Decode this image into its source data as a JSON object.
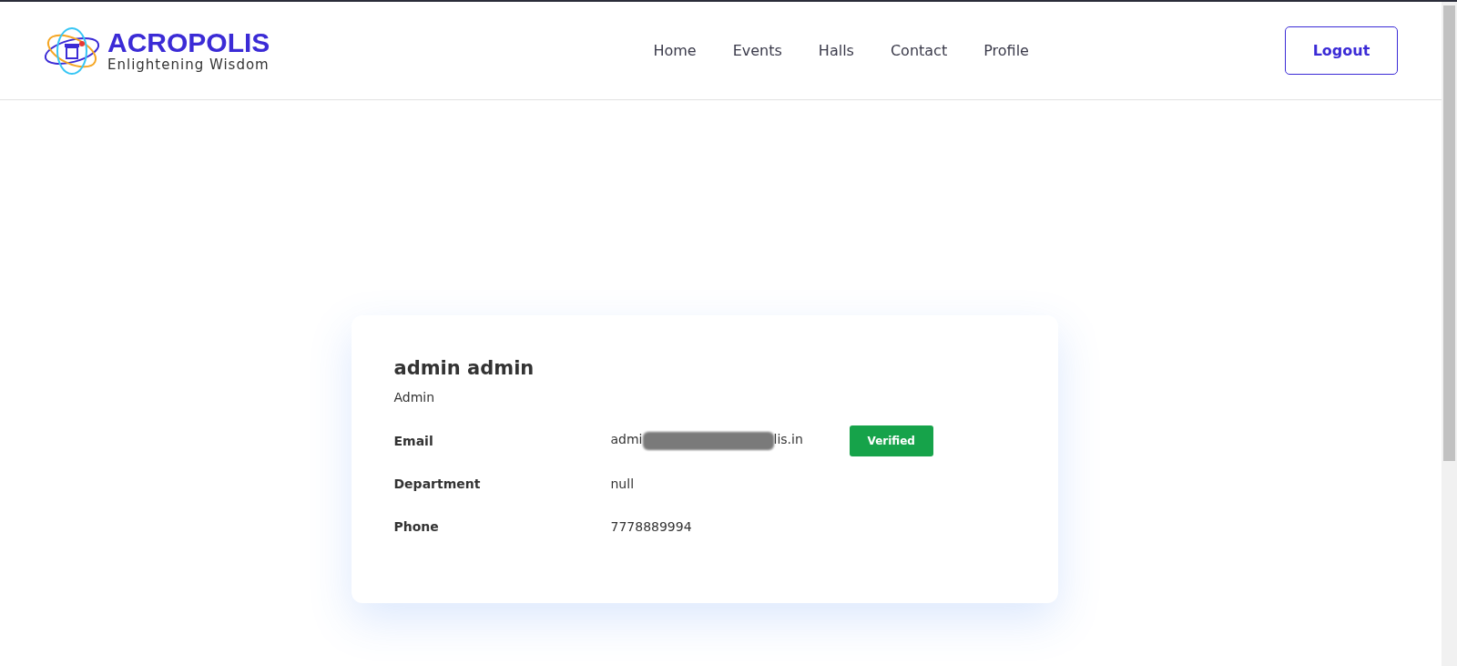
{
  "logo": {
    "name": "ACROPOLIS",
    "tagline": "Enlightening Wisdom"
  },
  "nav": [
    "Home",
    "Events",
    "Halls",
    "Contact",
    "Profile"
  ],
  "logout": "Logout",
  "profile": {
    "name": "admin admin",
    "role": "Admin",
    "fields": [
      {
        "kind": "email",
        "label": "Email",
        "value_start": "admi",
        "value_end": "lis.in",
        "redacted": true,
        "badge": "Verified"
      },
      {
        "kind": "text",
        "label": "Department",
        "value": "null"
      },
      {
        "kind": "text",
        "label": "Phone",
        "value": "7778889994"
      }
    ]
  }
}
